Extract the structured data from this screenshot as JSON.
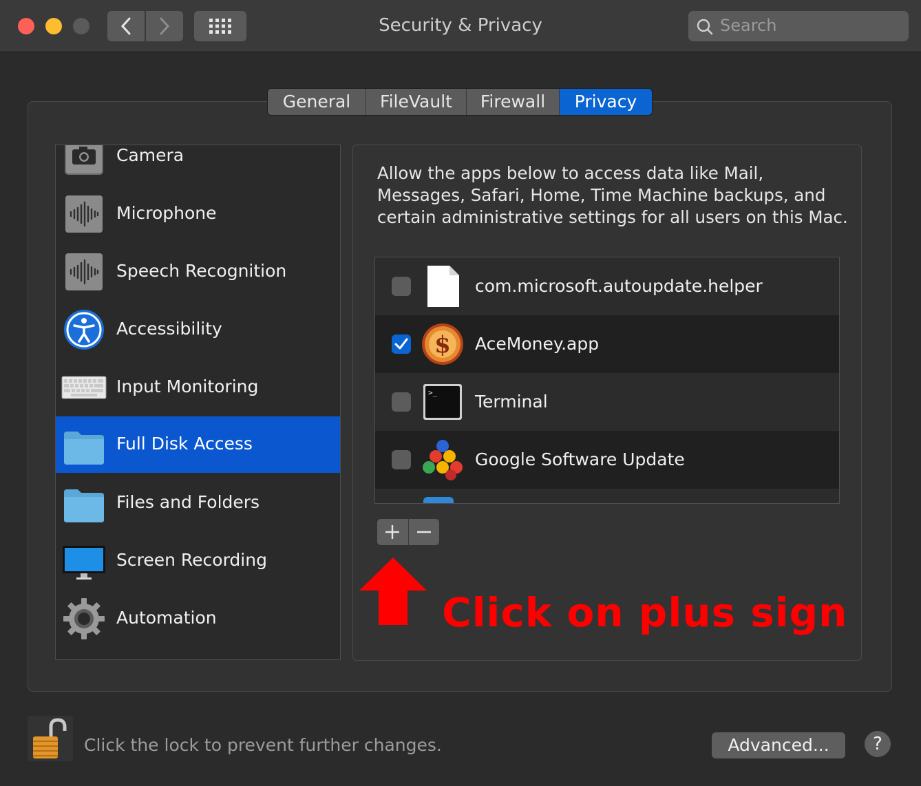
{
  "window": {
    "title": "Security & Privacy"
  },
  "search": {
    "placeholder": "Search"
  },
  "tabs": [
    {
      "label": "General"
    },
    {
      "label": "FileVault"
    },
    {
      "label": "Firewall"
    },
    {
      "label": "Privacy",
      "active": true
    }
  ],
  "sidebar": {
    "items": [
      {
        "label": "Camera",
        "icon": "camera-icon"
      },
      {
        "label": "Microphone",
        "icon": "microphone-icon"
      },
      {
        "label": "Speech Recognition",
        "icon": "speech-recognition-icon"
      },
      {
        "label": "Accessibility",
        "icon": "accessibility-icon"
      },
      {
        "label": "Input Monitoring",
        "icon": "keyboard-icon"
      },
      {
        "label": "Full Disk Access",
        "icon": "folder-icon",
        "selected": true
      },
      {
        "label": "Files and Folders",
        "icon": "folder-icon"
      },
      {
        "label": "Screen Recording",
        "icon": "display-icon"
      },
      {
        "label": "Automation",
        "icon": "gear-icon"
      }
    ]
  },
  "panel": {
    "description_lines": [
      "Allow the apps below to access data like Mail,",
      "Messages, Safari, Home, Time Machine backups, and",
      "certain administrative settings for all users on this Mac."
    ],
    "apps": [
      {
        "name": "com.microsoft.autoupdate.helper",
        "checked": false,
        "icon": "document-icon"
      },
      {
        "name": "AceMoney.app",
        "checked": true,
        "icon": "acemoney-icon"
      },
      {
        "name": "Terminal",
        "checked": false,
        "icon": "terminal-icon"
      },
      {
        "name": "Google Software Update",
        "checked": false,
        "icon": "google-update-icon"
      }
    ],
    "add_label": "+",
    "remove_label": "—"
  },
  "annotation": {
    "text": "Click on plus sign",
    "color": "#ff0000"
  },
  "footer": {
    "lock_text": "Click the lock to prevent further changes.",
    "advanced_label": "Advanced...",
    "help_label": "?"
  },
  "colors": {
    "accent": "#0a64d2",
    "selection": "#0a57cf",
    "background": "#2b2b2b"
  }
}
